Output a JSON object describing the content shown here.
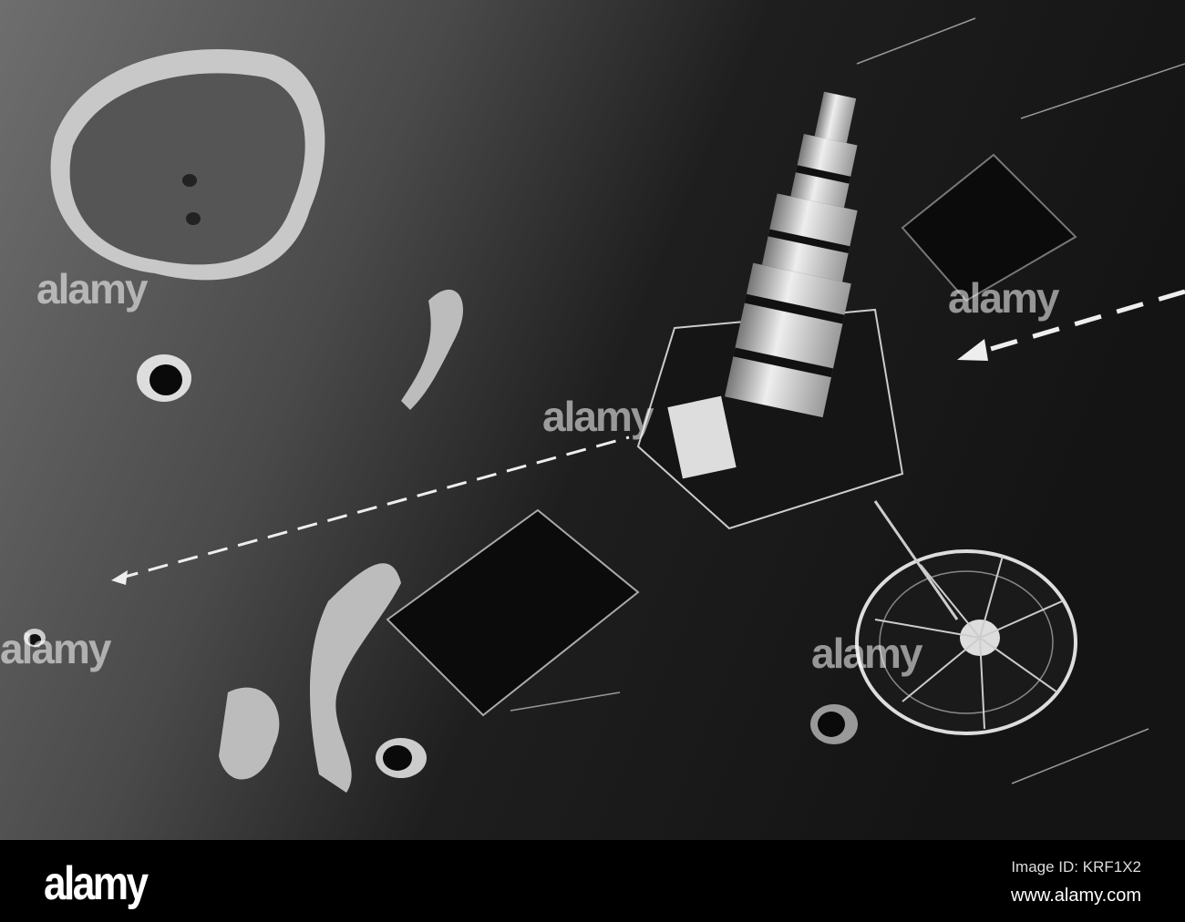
{
  "watermark": {
    "text": "alamy"
  },
  "footer": {
    "logo": "alamy",
    "image_id": "Image ID: KRF1X2",
    "website": "www.alamy.com"
  }
}
